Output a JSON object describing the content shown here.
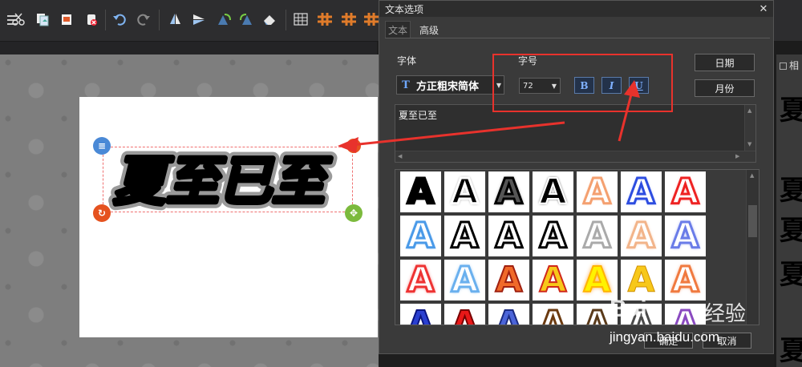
{
  "dialog": {
    "title": "文本选项",
    "close": "✕",
    "tabs": [
      {
        "label": "文本"
      },
      {
        "label": "高级"
      }
    ],
    "font_label": "字体",
    "size_label": "字号",
    "font_value": "方正粗宋简体",
    "size_value": "72",
    "bold": "B",
    "italic": "I",
    "underline": "U",
    "date_button": "日期",
    "month_button": "月份",
    "text_value": "夏至已至",
    "ok": "确定",
    "cancel": "取消"
  },
  "canvas": {
    "art_text": "夏至已至"
  },
  "right_panel": {
    "label": "相",
    "chars": [
      "夏",
      "夏",
      "夏",
      "夏",
      "夏"
    ]
  },
  "style_letter": "A",
  "watermark": {
    "brand": "Bai",
    "brand2": "经验",
    "url": "jingyan.baidu.com"
  },
  "colors": {
    "highlight": "#e8322c",
    "arrow": "#e8322c",
    "dialog_bg": "#3a3a3a"
  }
}
